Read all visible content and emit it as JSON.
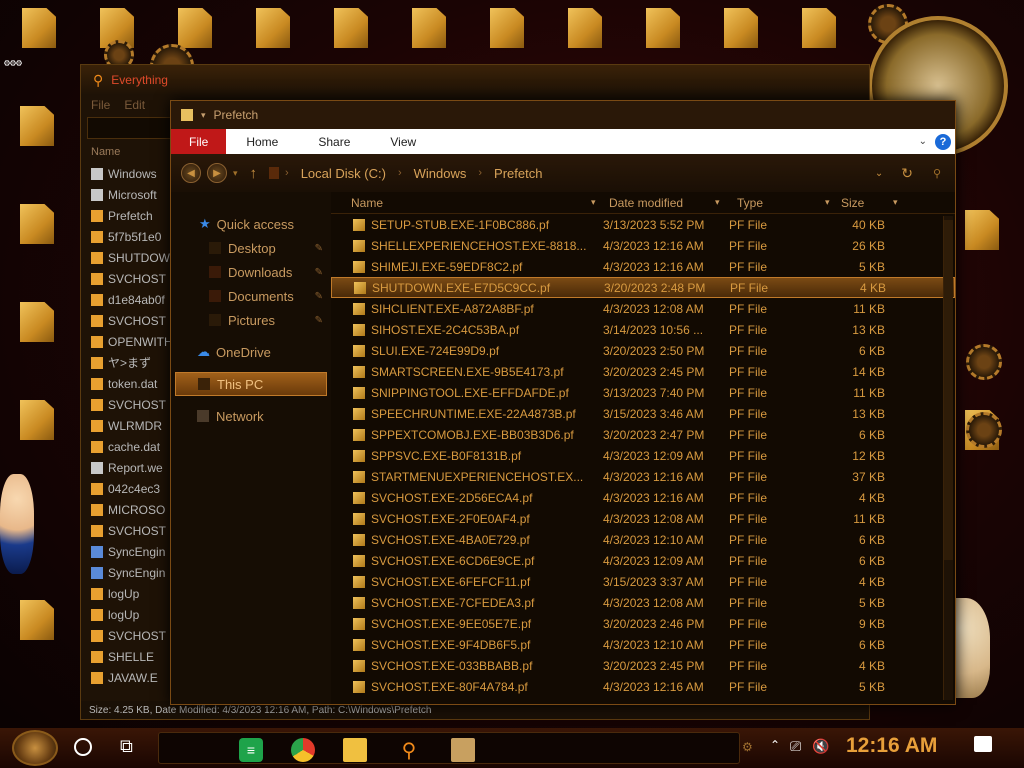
{
  "everything": {
    "title": "Everything",
    "menu": [
      "File",
      "Edit"
    ],
    "column_name": "Name",
    "rows": [
      {
        "name": "Windows",
        "icon": "file-icon"
      },
      {
        "name": "Microsoft",
        "icon": "file-icon"
      },
      {
        "name": "Prefetch",
        "icon": "folder-icon"
      },
      {
        "name": "5f7b5f1e0",
        "icon": "folder-icon"
      },
      {
        "name": "SHUTDOW",
        "icon": "folder-icon"
      },
      {
        "name": "SVCHOST",
        "icon": "folder-icon"
      },
      {
        "name": "d1e84ab0f",
        "icon": "folder-icon"
      },
      {
        "name": "SVCHOST",
        "icon": "folder-icon"
      },
      {
        "name": "OPENWITH",
        "icon": "folder-icon"
      },
      {
        "name": "ヤ>まず",
        "icon": "folder-icon"
      },
      {
        "name": "token.dat",
        "icon": "folder-icon"
      },
      {
        "name": "SVCHOST",
        "icon": "folder-icon"
      },
      {
        "name": "WLRMDR",
        "icon": "folder-icon"
      },
      {
        "name": "cache.dat",
        "icon": "folder-icon"
      },
      {
        "name": "Report.we",
        "icon": "file-icon"
      },
      {
        "name": "042c4ec3",
        "icon": "folder-icon"
      },
      {
        "name": "MICROSO",
        "icon": "folder-icon"
      },
      {
        "name": "SVCHOST",
        "icon": "folder-icon"
      },
      {
        "name": "SyncEngin",
        "icon": "blue-file-icon"
      },
      {
        "name": "SyncEngin",
        "icon": "blue-file-icon"
      },
      {
        "name": "logUp",
        "icon": "folder-icon"
      },
      {
        "name": "logUp",
        "icon": "folder-icon"
      },
      {
        "name": "SVCHOST",
        "icon": "folder-icon"
      },
      {
        "name": "SHELLE",
        "icon": "folder-icon"
      },
      {
        "name": "JAVAW.E",
        "icon": "folder-icon"
      }
    ],
    "status": "Size: 4.25 KB, Date Modified: 4/3/2023 12:16 AM, Path: C:\\Windows\\Prefetch"
  },
  "explorer": {
    "title": "Prefetch",
    "ribbon_tabs": [
      "File",
      "Home",
      "Share",
      "View"
    ],
    "breadcrumb": [
      "Local Disk (C:)",
      "Windows",
      "Prefetch"
    ],
    "nav": {
      "quick_access": "Quick access",
      "desktop": "Desktop",
      "downloads": "Downloads",
      "documents": "Documents",
      "pictures": "Pictures",
      "onedrive": "OneDrive",
      "this_pc": "This PC",
      "network": "Network"
    },
    "columns": {
      "name": "Name",
      "date": "Date modified",
      "type": "Type",
      "size": "Size"
    },
    "files": [
      {
        "name": "SETUP-STUB.EXE-1F0BC886.pf",
        "date": "3/13/2023 5:52 PM",
        "type": "PF File",
        "size": "40 KB"
      },
      {
        "name": "SHELLEXPERIENCEHOST.EXE-8818...",
        "date": "4/3/2023 12:16 AM",
        "type": "PF File",
        "size": "26 KB"
      },
      {
        "name": "SHIMEJI.EXE-59EDF8C2.pf",
        "date": "4/3/2023 12:16 AM",
        "type": "PF File",
        "size": "5 KB"
      },
      {
        "name": "SHUTDOWN.EXE-E7D5C9CC.pf",
        "date": "3/20/2023 2:48 PM",
        "type": "PF File",
        "size": "4 KB",
        "selected": true
      },
      {
        "name": "SIHCLIENT.EXE-A872A8BF.pf",
        "date": "4/3/2023 12:08 AM",
        "type": "PF File",
        "size": "11 KB"
      },
      {
        "name": "SIHOST.EXE-2C4C53BA.pf",
        "date": "3/14/2023 10:56 ...",
        "type": "PF File",
        "size": "13 KB"
      },
      {
        "name": "SLUI.EXE-724E99D9.pf",
        "date": "3/20/2023 2:50 PM",
        "type": "PF File",
        "size": "6 KB"
      },
      {
        "name": "SMARTSCREEN.EXE-9B5E4173.pf",
        "date": "3/20/2023 2:45 PM",
        "type": "PF File",
        "size": "14 KB"
      },
      {
        "name": "SNIPPINGTOOL.EXE-EFFDAFDE.pf",
        "date": "3/13/2023 7:40 PM",
        "type": "PF File",
        "size": "11 KB"
      },
      {
        "name": "SPEECHRUNTIME.EXE-22A4873B.pf",
        "date": "3/15/2023 3:46 AM",
        "type": "PF File",
        "size": "13 KB"
      },
      {
        "name": "SPPEXTCOMOBJ.EXE-BB03B3D6.pf",
        "date": "3/20/2023 2:47 PM",
        "type": "PF File",
        "size": "6 KB"
      },
      {
        "name": "SPPSVC.EXE-B0F8131B.pf",
        "date": "4/3/2023 12:09 AM",
        "type": "PF File",
        "size": "12 KB"
      },
      {
        "name": "STARTMENUEXPERIENCEHOST.EX...",
        "date": "4/3/2023 12:16 AM",
        "type": "PF File",
        "size": "37 KB"
      },
      {
        "name": "SVCHOST.EXE-2D56ECA4.pf",
        "date": "4/3/2023 12:16 AM",
        "type": "PF File",
        "size": "4 KB"
      },
      {
        "name": "SVCHOST.EXE-2F0E0AF4.pf",
        "date": "4/3/2023 12:08 AM",
        "type": "PF File",
        "size": "11 KB"
      },
      {
        "name": "SVCHOST.EXE-4BA0E729.pf",
        "date": "4/3/2023 12:10 AM",
        "type": "PF File",
        "size": "6 KB"
      },
      {
        "name": "SVCHOST.EXE-6CD6E9CE.pf",
        "date": "4/3/2023 12:09 AM",
        "type": "PF File",
        "size": "6 KB"
      },
      {
        "name": "SVCHOST.EXE-6FEFCF11.pf",
        "date": "3/15/2023 3:37 AM",
        "type": "PF File",
        "size": "4 KB"
      },
      {
        "name": "SVCHOST.EXE-7CFEDEA3.pf",
        "date": "4/3/2023 12:08 AM",
        "type": "PF File",
        "size": "5 KB"
      },
      {
        "name": "SVCHOST.EXE-9EE05E7E.pf",
        "date": "3/20/2023 2:46 PM",
        "type": "PF File",
        "size": "9 KB"
      },
      {
        "name": "SVCHOST.EXE-9F4DB6F5.pf",
        "date": "4/3/2023 12:10 AM",
        "type": "PF File",
        "size": "6 KB"
      },
      {
        "name": "SVCHOST.EXE-033BBABB.pf",
        "date": "3/20/2023 2:45 PM",
        "type": "PF File",
        "size": "4 KB"
      },
      {
        "name": "SVCHOST.EXE-80F4A784.pf",
        "date": "4/3/2023 12:16 AM",
        "type": "PF File",
        "size": "5 KB"
      }
    ]
  },
  "taskbar": {
    "time": "12:16 AM",
    "pinned": [
      "green-app-icon",
      "chrome-icon",
      "file-explorer-icon",
      "everything-search-icon",
      "game-icon"
    ]
  }
}
